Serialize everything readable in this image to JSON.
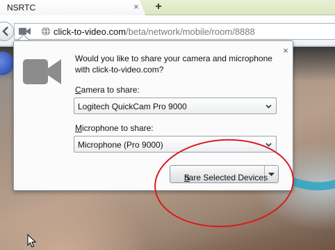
{
  "tabs": [
    {
      "title": "NSRTC",
      "close_glyph": "×",
      "active": true
    }
  ],
  "new_tab_glyph": "+",
  "navbar": {
    "back_icon": "arrow-left-icon",
    "site_identity_icon": "video-camera-icon",
    "globe_icon": "globe-icon",
    "url_host": "click-to-video.com",
    "url_path": "/beta/network/mobile/room/8888"
  },
  "permission_panel": {
    "icon": "video-camera-icon",
    "close_glyph": "×",
    "question": "Would you like to share your camera and microphone with click-to-video.com?",
    "camera_label_accesskey": "C",
    "camera_label_rest": "amera to share:",
    "camera_selected": "Logitech QuickCam Pro 9000",
    "microphone_label_accesskey": "M",
    "microphone_label_rest": "icrophone to share:",
    "microphone_selected": "Microphone (Pro 9000)",
    "share_button_accesskey": "S",
    "share_button_rest": "hare Selected Devices",
    "share_dropdown_icon": "chevron-down-icon"
  },
  "annotation": {
    "color": "#d9181e",
    "shape": "ellipse"
  },
  "colors": {
    "tabstrip": "#dbe6bf",
    "panel_background": "#fbfbfb",
    "annotation_red": "#d9181e"
  }
}
